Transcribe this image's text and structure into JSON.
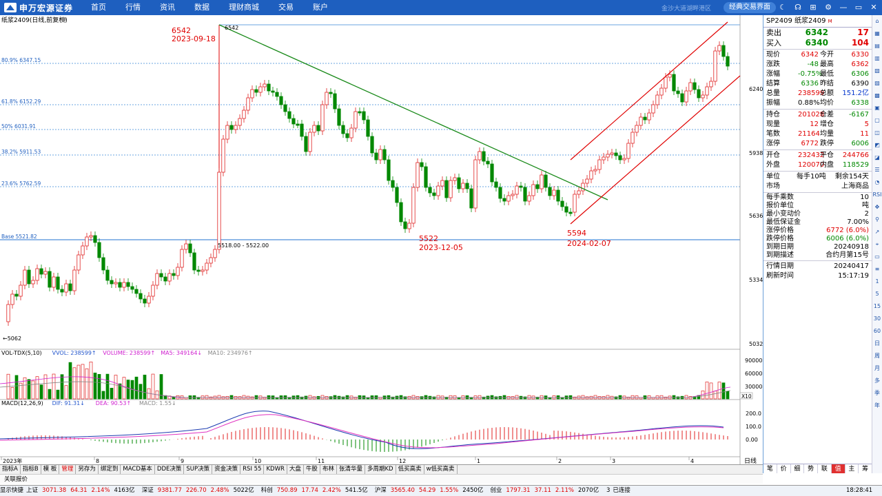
{
  "app": {
    "logo_text": "申万宏源证券",
    "slogan": "金沙大道湖畔港区",
    "classic_btn": "经典交易界面"
  },
  "nav": [
    "首页",
    "行情",
    "资讯",
    "数据",
    "理财商城",
    "交易",
    "账户"
  ],
  "window_icons": [
    "moon-icon",
    "headset-icon",
    "grid-icon",
    "gear-icon",
    "minimize-icon",
    "restore-icon",
    "close-icon"
  ],
  "chart": {
    "title": "纸浆2409(日线,前复权)",
    "fib_labels": [
      "80.9% 6347.15",
      "61.8% 6152.29",
      "50% 6031.91",
      "38.2% 5911.53",
      "23.6% 5762.59",
      "Base 5521.82"
    ],
    "annotations": [
      {
        "text": "6542",
        "color": "#e00000"
      },
      {
        "text": "2023-09-18",
        "color": "#e00000"
      },
      {
        "text": "5522",
        "color": "#e00000"
      },
      {
        "text": "2023-12-05",
        "color": "#e00000"
      },
      {
        "text": "5594",
        "color": "#e00000"
      },
      {
        "text": "2024-02-07",
        "color": "#e00000"
      }
    ],
    "small_labels": {
      "high": "6542",
      "low": "5062",
      "range": "5518.00 - 5522.00"
    },
    "price_axis": [
      "6240",
      "5938",
      "5636",
      "5334",
      "5032"
    ],
    "vol_axis": [
      "90000",
      "60000",
      "30000"
    ],
    "vol_x": "X10",
    "macd_axis": [
      "200.0",
      "100.0",
      "0.00"
    ],
    "time_axis": [
      "2023年",
      "8",
      "9",
      "10",
      "11",
      "12",
      "1",
      "2",
      "3",
      "4"
    ],
    "period": "日线",
    "vol_legend": [
      {
        "text": "VOL-TDX(5,10)",
        "cls": "ptitle"
      },
      {
        "text": "VVOL: 238599↑",
        "cls": "p-blue"
      },
      {
        "text": "VOLUME: 238599↑",
        "cls": "p-mag"
      },
      {
        "text": "MA5: 349164↓",
        "cls": "p-mag"
      },
      {
        "text": "MA10: 234976↑",
        "cls": "p-gray"
      }
    ],
    "macd_legend": [
      {
        "text": "MACD(12,26,9)",
        "cls": "ptitle"
      },
      {
        "text": "DIF: 91.31↓",
        "cls": "p-blue"
      },
      {
        "text": "DEA: 90.53↑",
        "cls": "p-mag"
      },
      {
        "text": "MACD: 1.55↓",
        "cls": "p-gray"
      }
    ]
  },
  "quote": {
    "code": "SP2409",
    "name": "纸浆2409",
    "sub": "M",
    "sell_label": "卖出",
    "sell_price": "6342",
    "sell_vol": "17",
    "buy_label": "买入",
    "buy_price": "6340",
    "buy_vol": "104",
    "grid1": [
      [
        "现价",
        "6342",
        "今开",
        "6330",
        "red",
        "red"
      ],
      [
        "涨跌",
        "-48",
        "最高",
        "6362",
        "green",
        "red"
      ],
      [
        "涨幅",
        "-0.75%",
        "最低",
        "6306",
        "green",
        "green"
      ],
      [
        "结算",
        "6336",
        "昨结",
        "6390",
        "green",
        "blk"
      ],
      [
        "总量",
        "238599",
        "总额",
        "151.2亿",
        "red",
        "blue"
      ],
      [
        "振幅",
        "0.88%",
        "均价",
        "6338",
        "blk",
        "green"
      ]
    ],
    "grid2": [
      [
        "持仓",
        "201028",
        "仓差",
        "-6167",
        "red",
        "green"
      ],
      [
        "现量",
        "12",
        "增仓",
        "5",
        "red",
        "red"
      ],
      [
        "笔数",
        "21164",
        "均量",
        "11",
        "red",
        "red"
      ],
      [
        "涨停",
        "6772",
        "跌停",
        "6006",
        "red",
        "green"
      ]
    ],
    "grid3": [
      [
        "开仓",
        "232432",
        "平仓",
        "244766",
        "red",
        "red"
      ],
      [
        "外盘",
        "120070",
        "内盘",
        "118529",
        "red",
        "green"
      ]
    ],
    "unit_label": "单位",
    "unit_value": "每手10吨",
    "remain": "剩余154天",
    "market_label": "市场",
    "market_value": "上海商品",
    "specs": [
      [
        "每手乘数",
        "10",
        "blk"
      ],
      [
        "报价单位",
        "吨",
        "blk"
      ],
      [
        "最小变动价",
        "2",
        "blk"
      ],
      [
        "最低保证金",
        "7.00%",
        "blk"
      ],
      [
        "涨停价格",
        "6772 (6.0%)",
        "red"
      ],
      [
        "跌停价格",
        "6006 (6.0%)",
        "green"
      ],
      [
        "到期日期",
        "20240918",
        "blk"
      ],
      [
        "到期描述",
        "合约月第15号",
        "blk"
      ]
    ],
    "date_label": "行情日期",
    "date_value": "20240417",
    "refresh_label": "刷新时间",
    "refresh_value": "15:17:19",
    "tabs": [
      "笔",
      "价",
      "细",
      "势",
      "联",
      "值",
      "主",
      "筹"
    ],
    "active_tab": "值"
  },
  "sidebar": [
    "⌂",
    "▦",
    "▤",
    "▥",
    "▧",
    "▨",
    "▩",
    "▣",
    "▢",
    "◫",
    "◩",
    "◪",
    "☰",
    "◔",
    "RSI",
    "✥",
    "⚲",
    "↗",
    "⌖",
    "▭",
    "≡",
    "1",
    "5",
    "15",
    "30",
    "60",
    "日",
    "周",
    "月",
    "多",
    "季",
    "年"
  ],
  "bottom_tabs": [
    "指标A",
    "指标B",
    "模 板",
    "管理",
    "另存为",
    "绑定到",
    "MACD基本",
    "DDE决策",
    "SUP决策",
    "资金决策",
    "RSI 55",
    "KDWR",
    "大盘",
    "牛股",
    "布林",
    "张清华量",
    "多周期KD",
    "低买高卖",
    "w低买高卖"
  ],
  "active_bottom_tab": "管理",
  "assoc_label": "关联报价",
  "status": {
    "show_label": "显示快捷",
    "items": [
      {
        "name": "上证",
        "price": "3071.38",
        "chg": "64.31",
        "pct": "2.14%",
        "amt": "4163亿"
      },
      {
        "name": "深证",
        "price": "9381.77",
        "chg": "226.70",
        "pct": "2.48%",
        "amt": "5022亿"
      },
      {
        "name": "科创",
        "price": "750.89",
        "chg": "17.74",
        "pct": "2.42%",
        "amt": "541.5亿"
      },
      {
        "name": "沪深",
        "price": "3565.40",
        "chg": "54.29",
        "pct": "1.55%",
        "amt": "2450亿"
      },
      {
        "name": "创业",
        "price": "1797.31",
        "chg": "37.11",
        "pct": "2.11%",
        "amt": "2070亿"
      }
    ],
    "conn_num": "3",
    "conn": "已连接",
    "time": "18:28:41"
  }
}
